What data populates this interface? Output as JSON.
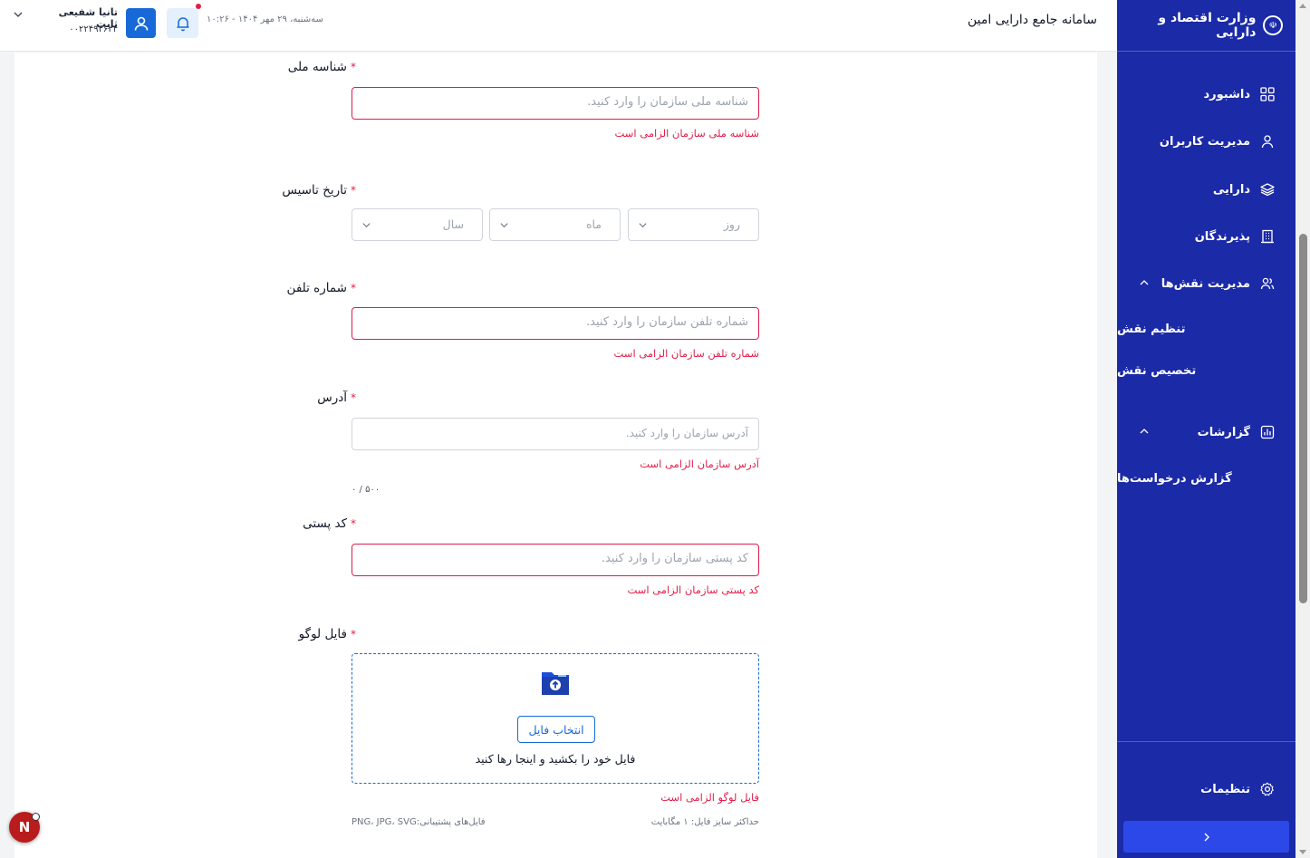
{
  "header": {
    "system_title": "سامانه جامع دارایی امین",
    "datetime": "سه‌شنبه، ۲۹ مهر ۱۴۰۴ - ۱۰:۲۶",
    "user_name": "تانیا شفیعی ثابت",
    "user_code": "۰۰۲۲۴۹۴۶۳۴"
  },
  "sidebar": {
    "brand": "وزارت اقتصاد و دارایی",
    "items": [
      {
        "label": "داشبورد",
        "icon": "grid-icon"
      },
      {
        "label": "مدیریت کاربران",
        "icon": "user-icon"
      },
      {
        "label": "دارایی",
        "icon": "layers-icon"
      },
      {
        "label": "پذیرندگان",
        "icon": "building-icon"
      },
      {
        "label": "مدیریت نقش‌ها",
        "icon": "users-icon"
      },
      {
        "label": "گزارشات",
        "icon": "report-icon"
      }
    ],
    "sub_roles": [
      "تنظیم نقش",
      "تخصیص نقش"
    ],
    "sub_reports": [
      "گزارش درخواست‌ها"
    ],
    "settings": "تنظیمات"
  },
  "form": {
    "national_id": {
      "label": "شناسه ملی",
      "placeholder": "شناسه ملی سازمان را وارد کنید.",
      "error": "شناسه ملی سازمان الزامی است"
    },
    "founding_date": {
      "label": "تاریخ تاسیس",
      "day": "روز",
      "month": "ماه",
      "year": "سال"
    },
    "phone": {
      "label": "شماره تلفن",
      "placeholder": "شماره تلفن سازمان را وارد کنید.",
      "error": "شماره تلفن سازمان الزامی است"
    },
    "address": {
      "label": "آدرس",
      "placeholder": "آدرس سازمان را وارد کنید.",
      "error": "آدرس سازمان الزامی است",
      "counter": "۰ / ۵۰۰"
    },
    "postal_code": {
      "label": "کد پستی",
      "placeholder": "کد پستی سازمان را وارد کنید.",
      "error": "کد پستی سازمان الزامی است"
    },
    "logo": {
      "label": "فایل لوگو",
      "button": "انتخاب فایل",
      "drag_text": "فایل خود را بکشید و اینجا رها کنید",
      "error": "فایل لوگو الزامی است",
      "max_size": "حداکثر سایز فایل: ۱ مگابایت",
      "formats": "فایل‌های پشتیبانی:PNG، JPG، SVG"
    },
    "required_mark": "*"
  },
  "badge": {
    "letter": "N"
  },
  "colors": {
    "sidebar": "#1b2aa6",
    "primary": "#1769d8",
    "error": "#e11d48"
  }
}
